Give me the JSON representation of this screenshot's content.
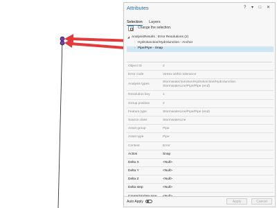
{
  "pane": {
    "title": "Attributes",
    "window_buttons": "? ▾ □ ✕",
    "tabs": [
      "Selection",
      "Layers"
    ],
    "change_selection": "Change the selection."
  },
  "tree": {
    "parent": "AnalysisResults : Error Resolutions (2)",
    "items": [
      "Hydrolunction/Hydrolunction - Anchor",
      "Pipe/Pipe - Snap"
    ]
  },
  "attributes": [
    {
      "key": "Object ID",
      "value": "2",
      "dark": false
    },
    {
      "key": "Error code",
      "value": "Vertex within tolerance",
      "dark": false
    },
    {
      "key": "Analysis types",
      "value": "Stormwater/Junction/Hydrolunction/Hydrolunction",
      "value2": "StormwaterLine/Pipe/Pipe (end)",
      "dark": false
    },
    {
      "key": "Resolution key",
      "value": "1",
      "dark": false
    },
    {
      "key": "Group position",
      "value": "2",
      "dark": false
    },
    {
      "key": "Feature type",
      "value": "StormwaterLine/Pipe/Pipe (end)",
      "dark": false
    },
    {
      "key": "Source class",
      "value": "StormwaterLine",
      "dark": false
    },
    {
      "key": "Asset group",
      "value": "Pipe",
      "dark": false
    },
    {
      "key": "Asset type",
      "value": "Pipe",
      "dark": false
    },
    {
      "key": "Context",
      "value": "Error",
      "dark": false
    },
    {
      "key": "Action",
      "value": "Snap",
      "dark": true
    },
    {
      "key": "Delta X",
      "value": "<Null>",
      "dark": true
    },
    {
      "key": "Delta Y",
      "value": "<Null>",
      "dark": true
    },
    {
      "key": "Delta Z",
      "value": "<Null>",
      "dark": true
    },
    {
      "key": "Delta step",
      "value": "<Null>",
      "dark": true
    },
    {
      "key": "Create/Update type",
      "value": "<Null>",
      "dark": true
    }
  ],
  "footer": {
    "auto_apply_label": "Auto Apply",
    "auto_apply_on": false,
    "apply_label": "Apply",
    "cancel_label": "Cancel"
  },
  "colors": {
    "accent": "#1f73b7",
    "arrow": "#e23b3b",
    "selection": "#cfe6f5",
    "point": "#7a3fb4"
  }
}
